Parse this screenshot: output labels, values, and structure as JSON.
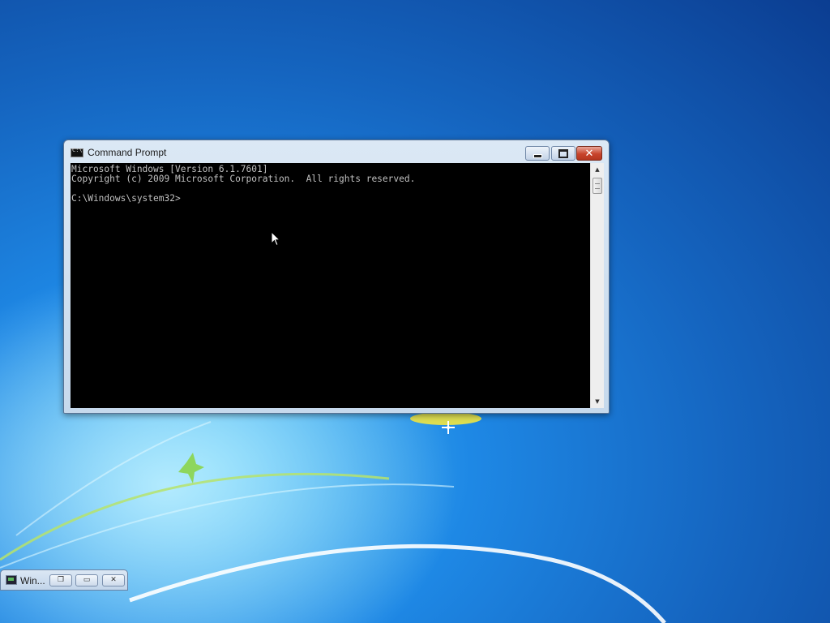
{
  "window": {
    "title": "Command Prompt",
    "console_lines": [
      "Microsoft Windows [Version 6.1.7601]",
      "Copyright (c) 2009 Microsoft Corporation.  All rights reserved.",
      "",
      "C:\\Windows\\system32>"
    ],
    "icons": {
      "app": "cmd-icon",
      "minimize": "minimize-icon",
      "maximize": "maximize-icon",
      "close": "close-icon",
      "scroll_up": "scroll-up-arrow-icon",
      "scroll_down": "scroll-down-arrow-icon"
    },
    "colors": {
      "console_background": "#000000",
      "console_text": "#c0c0c0",
      "close_button": "#c8442c"
    }
  },
  "minimized_window": {
    "title": "Win...",
    "icons": [
      "restore-icon",
      "maximize-icon",
      "close-icon"
    ]
  },
  "desktop": {
    "background_color": "#1e88e5"
  }
}
